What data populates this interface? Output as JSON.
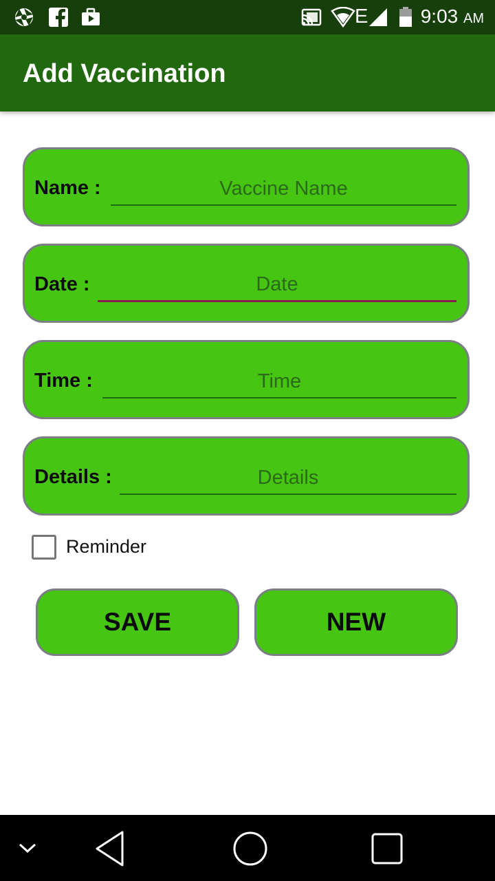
{
  "status_bar": {
    "icons_left": [
      "aperture-icon",
      "facebook-icon",
      "briefcase-play-icon"
    ],
    "icons_right": [
      "cast-icon",
      "signal-icon",
      "network-e-icon",
      "battery-icon"
    ],
    "network_type": "E",
    "time": "9:03",
    "ampm": "AM"
  },
  "app_bar": {
    "title": "Add Vaccination"
  },
  "form": {
    "fields": [
      {
        "label": "Name :",
        "placeholder": "Vaccine Name",
        "value": ""
      },
      {
        "label": "Date :",
        "placeholder": "Date",
        "value": ""
      },
      {
        "label": "Time :",
        "placeholder": "Time",
        "value": ""
      },
      {
        "label": "Details :",
        "placeholder": "Details",
        "value": ""
      }
    ],
    "reminder": {
      "label": "Reminder",
      "checked": false
    }
  },
  "actions": {
    "save_label": "SAVE",
    "new_label": "NEW"
  },
  "nav_bar": {
    "icons": [
      "chevron-down-icon",
      "back-icon",
      "home-icon",
      "recents-icon"
    ]
  },
  "colors": {
    "status_bar": "#163f0b",
    "app_bar": "#21680e",
    "card_fill": "#47c513",
    "card_border": "#7a7f86",
    "focus_underline": "#8d1a4b"
  }
}
